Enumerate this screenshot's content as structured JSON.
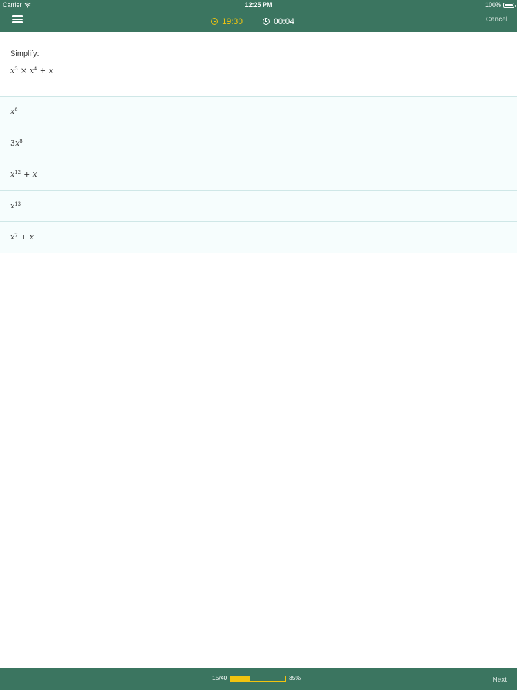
{
  "status_bar": {
    "carrier": "Carrier",
    "time": "12:25 PM",
    "battery": "100%",
    "battery_level": 1.0
  },
  "nav": {
    "menu_icon": "hamburger-menu-icon",
    "timer_remaining": "19:30",
    "timer_elapsed": "00:04",
    "cancel_label": "Cancel"
  },
  "question": {
    "prompt": "Simplify:",
    "expression": {
      "a_base": "x",
      "a_exp": "3",
      "times": "×",
      "b_base": "x",
      "b_exp": "4",
      "plus": "+",
      "c": "x"
    }
  },
  "answers": [
    {
      "coef": "",
      "base": "x",
      "exp": "8",
      "op": "",
      "tail": ""
    },
    {
      "coef": "3",
      "base": "x",
      "exp": "8",
      "op": "",
      "tail": ""
    },
    {
      "coef": "",
      "base": "x",
      "exp": "12",
      "op": "+",
      "tail": "x"
    },
    {
      "coef": "",
      "base": "x",
      "exp": "13",
      "op": "",
      "tail": ""
    },
    {
      "coef": "",
      "base": "x",
      "exp": "7",
      "op": "+",
      "tail": "x"
    }
  ],
  "progress": {
    "count": "15/40",
    "percent": "35%",
    "fill_fraction": 0.35
  },
  "footer": {
    "next_label": "Next"
  },
  "colors": {
    "bar_green": "#3b7560",
    "accent_yellow": "#f1c40f",
    "answer_background": "#f6fdfd",
    "answer_border": "#cfe7e7"
  }
}
